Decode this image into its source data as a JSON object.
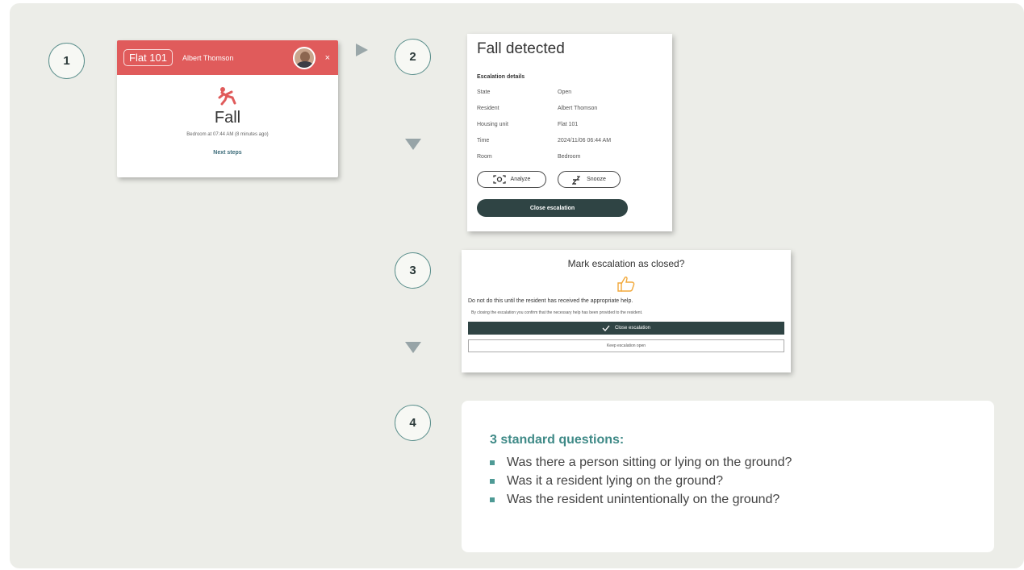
{
  "steps": [
    "1",
    "2",
    "3",
    "4"
  ],
  "alert": {
    "flat": "Flat 101",
    "resident": "Albert Thomson",
    "close_symbol": "×",
    "icon": "fall-person-icon",
    "title": "Fall",
    "subtitle": "Bedroom at 07:44 AM (8 minutes ago)",
    "next_steps": "Next steps",
    "header_color": "#e05b5b"
  },
  "detail": {
    "title": "Fall detected",
    "section": "Escalation details",
    "rows": [
      {
        "label": "State",
        "value": "Open"
      },
      {
        "label": "Resident",
        "value": "Albert Thomson"
      },
      {
        "label": "Housing unit",
        "value": "Flat 101"
      },
      {
        "label": "Time",
        "value": "2024/11/06 06:44 AM"
      },
      {
        "label": "Room",
        "value": "Bedroom"
      }
    ],
    "analyze_label": "Analyze",
    "snooze_label": "Snooze",
    "close_label": "Close escalation"
  },
  "confirm": {
    "title": "Mark escalation as closed?",
    "warning": "Do not do this until the resident has received the appropriate help.",
    "note": "By closing the escalation you confirm that the necessary help has been provided to the resident.",
    "close_label": "Close escalation",
    "keep_label": "Keep escalation open"
  },
  "questions": {
    "title": "3 standard questions:",
    "items": [
      "Was there a person sitting or lying on the ground?",
      "Was it a resident lying on the ground?",
      "Was the resident unintentionally on the ground?"
    ]
  },
  "colors": {
    "background": "#ecede8",
    "accent": "#3f8a87",
    "dark_button": "#2f4444"
  }
}
